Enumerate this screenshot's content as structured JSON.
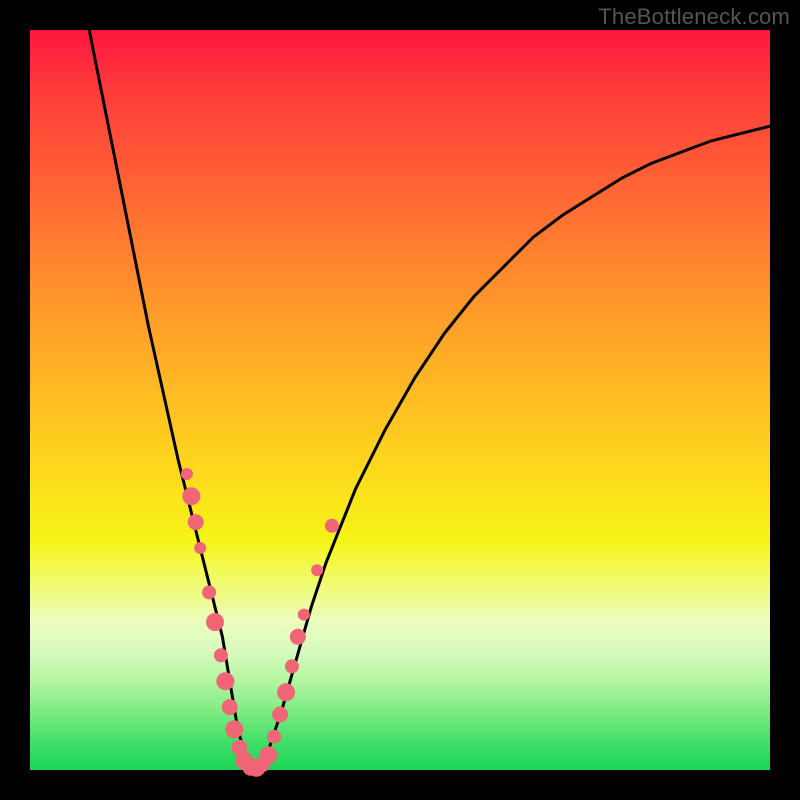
{
  "watermark": "TheBottleneck.com",
  "chart_data": {
    "type": "line",
    "title": "",
    "xlabel": "",
    "ylabel": "",
    "xlim": [
      0,
      100
    ],
    "ylim": [
      0,
      100
    ],
    "grid": false,
    "series": [
      {
        "name": "bottleneck-curve",
        "x": [
          8,
          10,
          12,
          14,
          16,
          18,
          20,
          22,
          24,
          26,
          27,
          28,
          29,
          30,
          32,
          34,
          36,
          38,
          40,
          44,
          48,
          52,
          56,
          60,
          64,
          68,
          72,
          76,
          80,
          84,
          88,
          92,
          96,
          100
        ],
        "y": [
          100,
          90,
          80,
          70,
          60,
          51,
          42,
          34,
          26,
          18,
          12,
          6,
          2,
          0,
          2,
          8,
          15,
          22,
          28,
          38,
          46,
          53,
          59,
          64,
          68,
          72,
          75,
          77.5,
          80,
          82,
          83.5,
          85,
          86,
          87
        ]
      }
    ],
    "scatter": {
      "name": "sample-points",
      "color": "#f06677",
      "points": [
        {
          "x": 21.2,
          "y": 40.0,
          "r": 6
        },
        {
          "x": 21.8,
          "y": 37.0,
          "r": 9
        },
        {
          "x": 22.4,
          "y": 33.5,
          "r": 8
        },
        {
          "x": 23.0,
          "y": 30.0,
          "r": 6
        },
        {
          "x": 24.2,
          "y": 24.0,
          "r": 7
        },
        {
          "x": 25.0,
          "y": 20.0,
          "r": 9
        },
        {
          "x": 25.8,
          "y": 15.5,
          "r": 7
        },
        {
          "x": 26.4,
          "y": 12.0,
          "r": 9
        },
        {
          "x": 27.0,
          "y": 8.5,
          "r": 8
        },
        {
          "x": 27.6,
          "y": 5.5,
          "r": 9
        },
        {
          "x": 28.3,
          "y": 3.0,
          "r": 8
        },
        {
          "x": 29.0,
          "y": 1.2,
          "r": 9
        },
        {
          "x": 29.8,
          "y": 0.3,
          "r": 8
        },
        {
          "x": 30.6,
          "y": 0.3,
          "r": 9
        },
        {
          "x": 31.4,
          "y": 0.8,
          "r": 8
        },
        {
          "x": 32.2,
          "y": 2.0,
          "r": 9
        },
        {
          "x": 33.0,
          "y": 4.5,
          "r": 7
        },
        {
          "x": 33.8,
          "y": 7.5,
          "r": 8
        },
        {
          "x": 34.6,
          "y": 10.5,
          "r": 9
        },
        {
          "x": 35.4,
          "y": 14.0,
          "r": 7
        },
        {
          "x": 36.2,
          "y": 18.0,
          "r": 8
        },
        {
          "x": 37.0,
          "y": 21.0,
          "r": 6
        },
        {
          "x": 38.8,
          "y": 27.0,
          "r": 6
        },
        {
          "x": 40.8,
          "y": 33.0,
          "r": 7
        }
      ]
    }
  }
}
